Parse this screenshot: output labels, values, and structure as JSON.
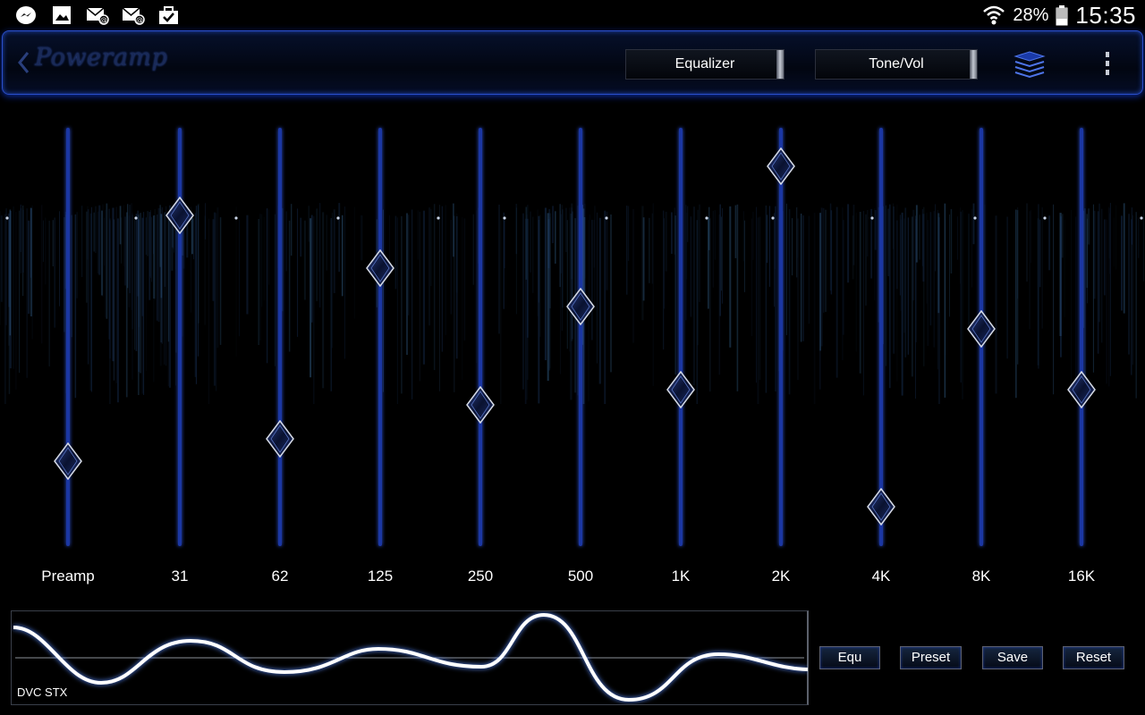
{
  "status_bar": {
    "icons": [
      "messenger-icon",
      "gallery-icon",
      "email-icon",
      "email-icon",
      "clipboard-check-icon"
    ],
    "battery": "28%",
    "time": "15:35"
  },
  "app_bar": {
    "logo": "Poweramp",
    "tabs": [
      "Equalizer",
      "Tone/Vol"
    ]
  },
  "equalizer": {
    "bands": [
      {
        "label": "Preamp",
        "level": 0.83
      },
      {
        "label": "31",
        "level": 0.18
      },
      {
        "label": "62",
        "level": 0.77
      },
      {
        "label": "125",
        "level": 0.32
      },
      {
        "label": "250",
        "level": 0.68
      },
      {
        "label": "500",
        "level": 0.42
      },
      {
        "label": "1K",
        "level": 0.64
      },
      {
        "label": "2K",
        "level": 0.05
      },
      {
        "label": "4K",
        "level": 0.95
      },
      {
        "label": "8K",
        "level": 0.48
      },
      {
        "label": "16K",
        "level": 0.64
      }
    ]
  },
  "curve": {
    "label": "DVC STX"
  },
  "buttons": {
    "equ": "Equ",
    "preset": "Preset",
    "save": "Save",
    "reset": "Reset"
  },
  "colors": {
    "accent": "#2e53d9",
    "background": "#000000"
  }
}
